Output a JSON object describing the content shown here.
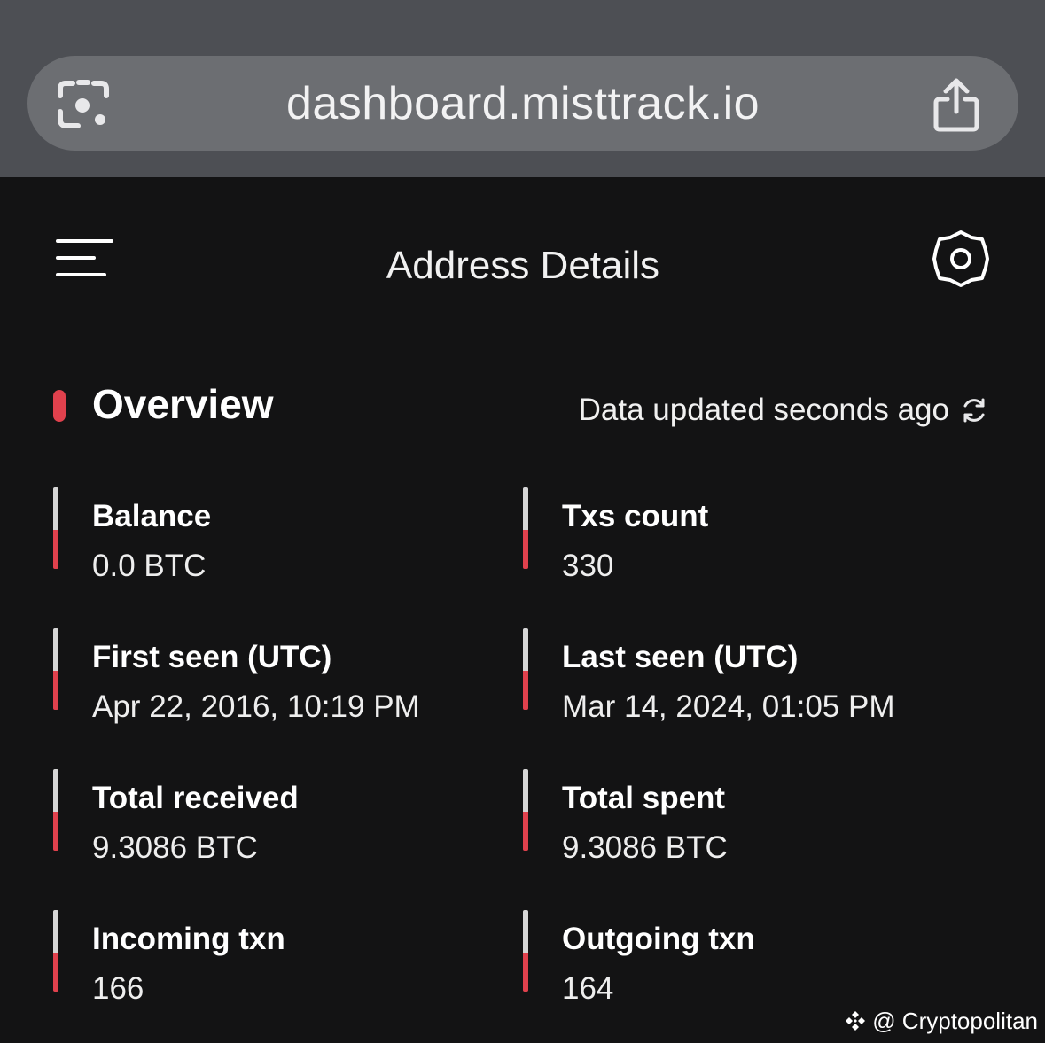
{
  "browser": {
    "url": "dashboard.misttrack.io",
    "lens_icon": "google-lens-icon",
    "share_icon": "share-icon"
  },
  "header": {
    "title": "Address Details",
    "menu_icon": "menu-icon",
    "settings_icon": "gear-icon"
  },
  "overview": {
    "title": "Overview",
    "updated_text": "Data updated seconds ago",
    "refresh_icon": "refresh-icon",
    "stats": [
      {
        "label": "Balance",
        "value": "0.0 BTC"
      },
      {
        "label": "Txs count",
        "value": "330"
      },
      {
        "label": "First seen (UTC)",
        "value": "Apr 22, 2016, 10:19 PM"
      },
      {
        "label": "Last seen (UTC)",
        "value": "Mar 14, 2024, 01:05 PM"
      },
      {
        "label": "Total received",
        "value": "9.3086 BTC"
      },
      {
        "label": "Total spent",
        "value": "9.3086 BTC"
      },
      {
        "label": "Incoming txn",
        "value": "166"
      },
      {
        "label": "Outgoing txn",
        "value": "164"
      }
    ]
  },
  "watermark": {
    "text": "@ Cryptopolitan",
    "logo_icon": "binance-logo-icon"
  },
  "colors": {
    "accent_red": "#e0414d",
    "background": "#131314",
    "browser_bar": "#4d4f54",
    "url_pill": "#6c6e72"
  }
}
